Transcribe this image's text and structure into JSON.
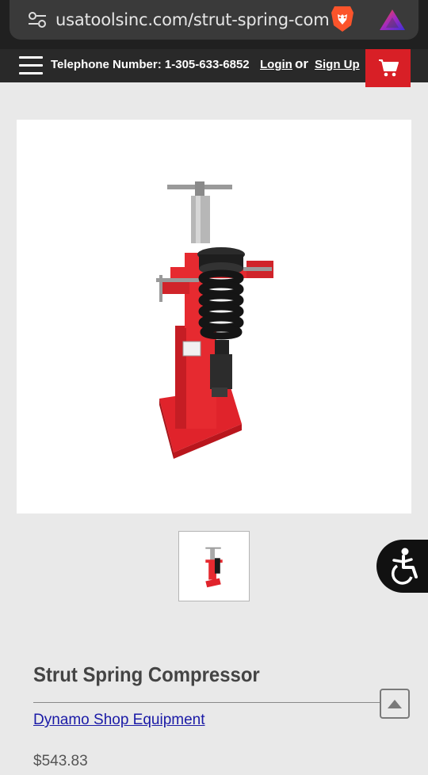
{
  "browser": {
    "url": "usatoolsinc.com/strut-spring-compressor",
    "icons": [
      "site-settings-icon",
      "brave-lion-icon",
      "brave-rewards-icon"
    ]
  },
  "header": {
    "menu_icon": "hamburger-menu-icon",
    "phone_label": "Telephone Number: 1-305-633-6852",
    "login_label": "Login",
    "or_label": "or",
    "signup_label": "Sign Up",
    "cart_icon": "shopping-cart-icon"
  },
  "colors": {
    "header_bg": "#292929",
    "accent_red": "#d81f26",
    "link_blue": "#1a1aa6",
    "page_bg": "#e9e9e9"
  },
  "product": {
    "title": "Strut Spring Compressor",
    "brand": "Dynamo Shop Equipment",
    "price": "$543.83",
    "image_icon": "strut-spring-compressor-image",
    "thumbnail_count": 1
  },
  "floating": {
    "accessibility_icon": "accessibility-icon",
    "scroll_top_icon": "scroll-to-top-icon"
  }
}
